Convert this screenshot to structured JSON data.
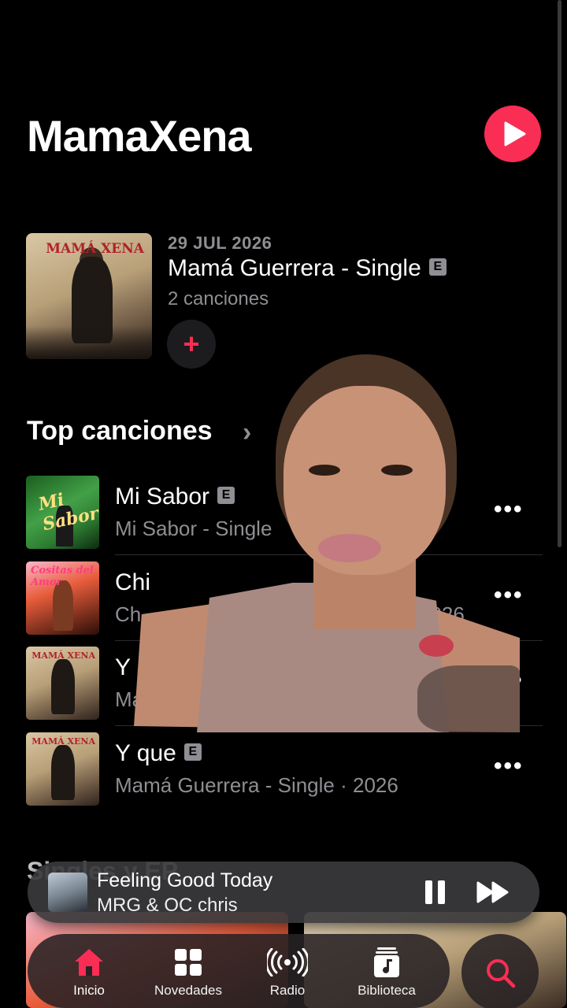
{
  "artist": {
    "name": "MamaXena"
  },
  "latest_release": {
    "date": "29 JUL 2026",
    "title": "Mamá Guerrera - Single",
    "explicit_badge": "E",
    "track_count": "2 canciones",
    "add_label": "+"
  },
  "top_songs": {
    "title": "Top canciones",
    "chevron": "›",
    "items": [
      {
        "title": "Mi Sabor",
        "explicit": "E",
        "subtitle": "Mi Sabor - Single",
        "more": "•••"
      },
      {
        "title": "Chi",
        "explicit": "",
        "subtitle": "Ch",
        "year_visible": "2026",
        "more": "•••"
      },
      {
        "title": "Y",
        "explicit": "",
        "subtitle": "Mamá Gu",
        "more": "•••"
      },
      {
        "title": "Y que",
        "explicit": "E",
        "subtitle": "Mamá Guerrera - Single · 2026",
        "more": "•••"
      }
    ]
  },
  "next_section": {
    "title": "Singles y EP"
  },
  "now_playing": {
    "title": "Feeling Good Today",
    "artist": "MRG & OC chris"
  },
  "tabs": [
    {
      "label": "Inicio",
      "icon": "house-icon",
      "active": true
    },
    {
      "label": "Novedades",
      "icon": "grid-icon",
      "active": false
    },
    {
      "label": "Radio",
      "icon": "radio-waves-icon",
      "active": false
    },
    {
      "label": "Biblioteca",
      "icon": "music-library-icon",
      "active": false
    }
  ],
  "colors": {
    "accent": "#fa2d55",
    "background": "#000000",
    "secondary_text": "#8e8e93"
  },
  "cover_text": {
    "big": "MAMÁ XENA",
    "green": "Mi Sabor",
    "pink": "Cositas del Amor"
  }
}
